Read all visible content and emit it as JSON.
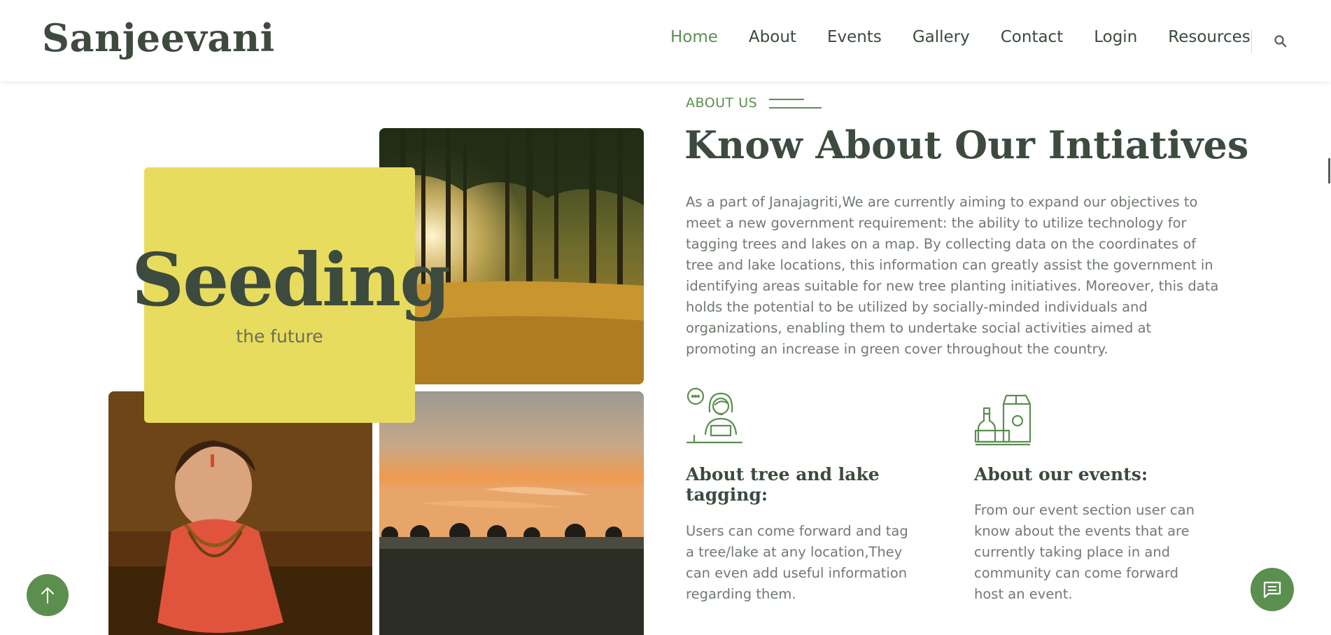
{
  "header": {
    "brand": "Sanjeevani",
    "nav": [
      {
        "label": "Home",
        "active": true
      },
      {
        "label": "About",
        "active": false
      },
      {
        "label": "Events",
        "active": false
      },
      {
        "label": "Gallery",
        "active": false
      },
      {
        "label": "Contact",
        "active": false
      },
      {
        "label": "Login",
        "active": false
      },
      {
        "label": "Resources",
        "active": false
      }
    ],
    "search_icon": "search-icon"
  },
  "hero": {
    "title": "Seeding",
    "subtitle": "the future"
  },
  "about": {
    "eyebrow": "ABOUT US",
    "heading": "Know About Our Intiatives",
    "intro": "As a part of Janajagriti,We are currently aiming to expand our objectives to meet a new government requirement: the ability to utilize technology for tagging trees and lakes on a map. By collecting data on the coordinates of tree and lake locations, this information can greatly assist the government in identifying areas suitable for new tree planting initiatives. Moreover, this data holds the potential to be utilized by socially-minded individuals and organizations, enabling them to undertake social activities aimed at promoting an increase in green cover throughout the country."
  },
  "features": [
    {
      "icon": "support-person-icon",
      "title": "About tree and lake tagging:",
      "text": "Users can come forward and tag a tree/lake at any location,They can even add useful information regarding them."
    },
    {
      "icon": "grocery-items-icon",
      "title": "About our events:",
      "text": "From our event section user can know about the events that are currently taking place in and community can come forward host an event."
    }
  ],
  "floating": {
    "scroll_top_icon": "arrow-up-icon",
    "chat_icon": "chat-icon"
  },
  "colors": {
    "accent": "#5b8f4f",
    "heading": "#3d4a3e",
    "body_text": "#717a70",
    "highlight_box": "#e8dc5e"
  }
}
